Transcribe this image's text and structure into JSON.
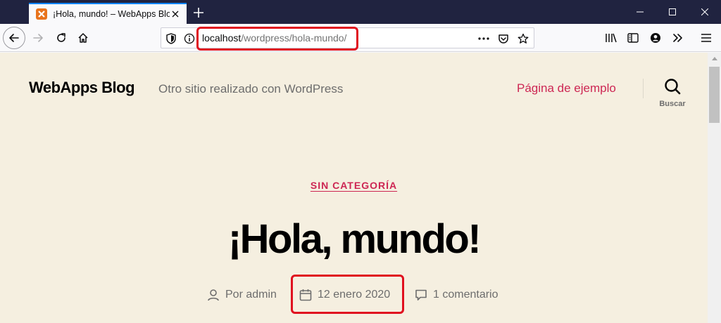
{
  "browser": {
    "tab": {
      "title": "¡Hola, mundo! – WebApps Blog",
      "favicon": "xampp-icon"
    },
    "url": {
      "host": "localhost",
      "path": "/wordpress/hola-mundo/"
    },
    "colors": {
      "titlebar": "#202340",
      "highlight": "#e0101f",
      "accent": "#0a84ff"
    }
  },
  "site": {
    "title": "WebApps Blog",
    "description": "Otro sitio realizado con WordPress",
    "menu_item": "Página de ejemplo",
    "search_label": "Buscar",
    "accent_color": "#cd2653"
  },
  "post": {
    "category": "SIN CATEGORÍA",
    "title": "¡Hola, mundo!",
    "author": "Por admin",
    "date": "12 enero 2020",
    "comments": "1 comentario"
  }
}
